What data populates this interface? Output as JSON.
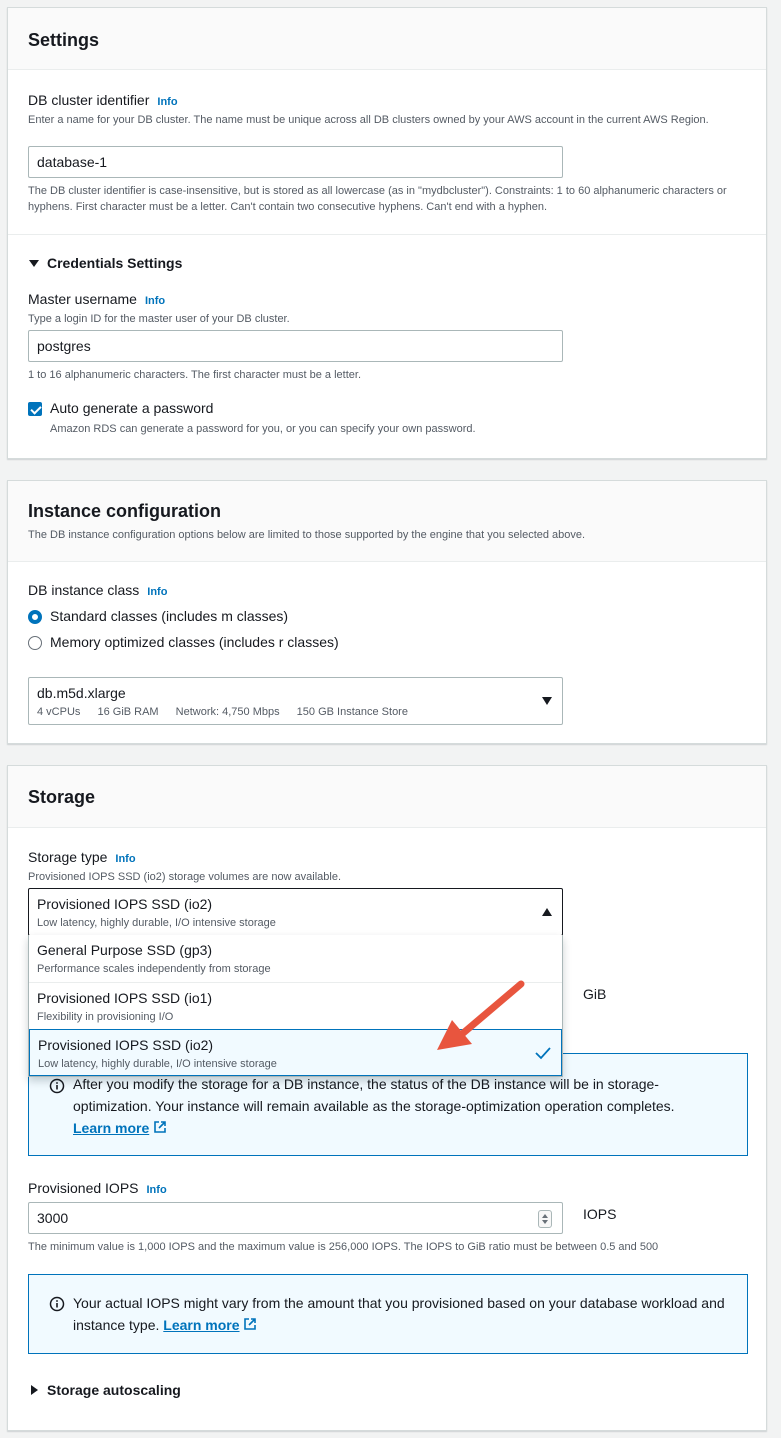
{
  "settings": {
    "title": "Settings",
    "cluster_id_label": "DB cluster identifier",
    "info": "Info",
    "cluster_id_desc": "Enter a name for your DB cluster. The name must be unique across all DB clusters owned by your AWS account in the current AWS Region.",
    "cluster_id_value": "database-1",
    "cluster_id_constraint": "The DB cluster identifier is case-insensitive, but is stored as all lowercase (as in \"mydbcluster\"). Constraints: 1 to 60 alphanumeric characters or hyphens. First character must be a letter. Can't contain two consecutive hyphens. Can't end with a hyphen.",
    "credentials_label": "Credentials Settings",
    "master_username_label": "Master username",
    "master_username_desc": "Type a login ID for the master user of your DB cluster.",
    "master_username_value": "postgres",
    "master_username_constraint": "1 to 16 alphanumeric characters. The first character must be a letter.",
    "auto_password_label": "Auto generate a password",
    "auto_password_desc": "Amazon RDS can generate a password for you, or you can specify your own password.",
    "auto_password_checked": true
  },
  "instance": {
    "title": "Instance configuration",
    "desc": "The DB instance configuration options below are limited to those supported by the engine that you selected above.",
    "class_label": "DB instance class",
    "info": "Info",
    "radio_standard": "Standard classes (includes m classes)",
    "radio_memory": "Memory optimized classes (includes r classes)",
    "selected_class": "db.m5d.xlarge",
    "spec_vcpu": "4 vCPUs",
    "spec_ram": "16 GiB RAM",
    "spec_network": "Network: 4,750 Mbps",
    "spec_store": "150 GB Instance Store"
  },
  "storage": {
    "title": "Storage",
    "type_label": "Storage type",
    "info": "Info",
    "type_note": "Provisioned IOPS SSD (io2) storage volumes are now available.",
    "selected_title": "Provisioned IOPS SSD (io2)",
    "selected_sub": "Low latency, highly durable, I/O intensive storage",
    "options": [
      {
        "title": "General Purpose SSD (gp3)",
        "sub": "Performance scales independently from storage"
      },
      {
        "title": "Provisioned IOPS SSD (io1)",
        "sub": "Flexibility in provisioning I/O"
      },
      {
        "title": "Provisioned IOPS SSD (io2)",
        "sub": "Low latency, highly durable, I/O intensive storage"
      }
    ],
    "gib_unit": "GiB",
    "alert1_text": "After you modify the storage for a DB instance, the status of the DB instance will be in storage-optimization. Your instance will remain available as the storage-optimization operation completes.",
    "alert1_link": "Learn more",
    "iops_label": "Provisioned IOPS",
    "iops_value": "3000",
    "iops_unit": "IOPS",
    "iops_constraint": "The minimum value is 1,000 IOPS and the maximum value is 256,000 IOPS. The IOPS to GiB ratio must be between 0.5 and 500",
    "alert2_text": "Your actual IOPS might vary from the amount that you provisioned based on your database workload and instance type.",
    "alert2_link": "Learn more",
    "autoscaling_label": "Storage autoscaling"
  },
  "colors": {
    "accent": "#0073bb",
    "annotation_arrow": "#e8553e"
  }
}
